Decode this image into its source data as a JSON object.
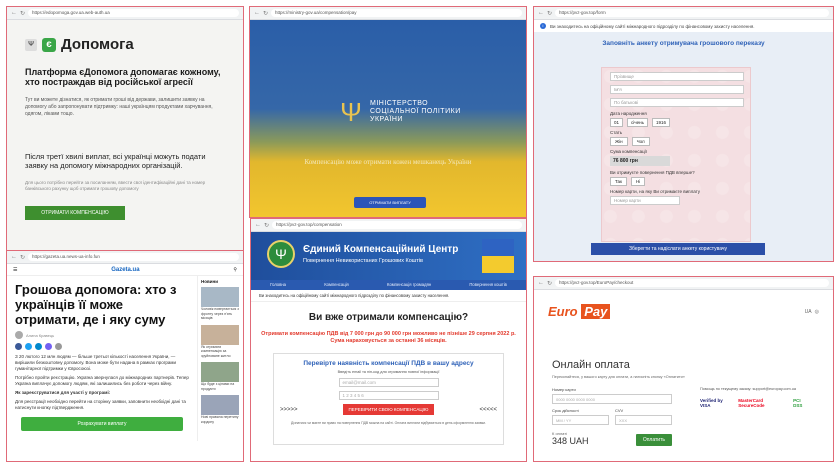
{
  "panel1": {
    "url": "https://edopomoga.gov.ua.web-auth.ua",
    "logo_name": "Допомога",
    "title": "Платформа єДопомога допомагає кожному, хто постраждав від російської агресії",
    "text": "Тут ви можете дізнатися, як отримати гроші від держави, залишити заявку на допомогу або запропонувати підтримку: наші українцям продуктами харчування, одягом, ліками тощо.",
    "subtitle": "Після третї хвилі виплат, всі українці можуть подати заявку на допомогу міжнародних організацій.",
    "small": "Для цього потрібно перейти за посиланням, ввести свої ідентифікаційні дані та номер банківського рахунку щоб отримати грошову допомогу",
    "button": "ОТРИМАТИ КОМПЕНСАЦІЮ"
  },
  "panel2": {
    "url": "https://ministry-gov.ua/compensation/pay",
    "ministry": [
      "МІНІСТЕРСТВО",
      "СОЦІАЛЬНОЇ ПОЛІТИКИ",
      "УКРАЇНИ"
    ],
    "caption": "Компенсацію може отримати кожен мешканець України",
    "button": "ОТРИМАТИ ВИПЛАТУ"
  },
  "panel3": {
    "url": "https://pvz-gov.top/form",
    "notice": "Ви знаходитесь на офіційному сайті міжнародного підрозділу по фінансовому захисту населення.",
    "title": "Заповніть анкету отримувача грошового переказу",
    "fields": [
      "Прізвище",
      "Ім'я",
      "По батькові"
    ],
    "birth_label": "Дата народження",
    "day": "01",
    "month": "січень",
    "year": "1916",
    "gender_label": "Стать",
    "gender_f": "Жін",
    "gender_m": "Чол",
    "sum_label": "Сума компенсації",
    "sum": "76 800 грн",
    "vat_label": "Ви отримуєте повернення ПДВ вперше?",
    "yes": "Так",
    "no": "Ні",
    "card_label": "Номер карти, на яку Ви отримаєте виплату",
    "card_placeholder": "Номер карти",
    "submit": "Зберегти та надіслати анкету користувачу"
  },
  "panel4": {
    "url": "https://gazeta.ua.news-ua-info.fun",
    "logo": "Gazeta.ua",
    "title": "Грошова допомога: хто з українців її може отримати, де і яку суму",
    "author": "Алина Кравець",
    "p1": "З 20 лютого 12 млн людям — більше третьої кількості населення України, — вирішили безкоштовну допомогу. Вона може бути надана в рамках програми гуманітарної підтримки у Євросоюзі.",
    "p2": "Потрібно пройти реєстрацію. Україна звернулася до міжнародних партнерів. Тепер Україна виплачує допомогу людям, які залишились без роботи через війну.",
    "h": "Як зареєструватися для участі у програмі:",
    "p3": "Для реєстрації необхідно перейти на сторінку заявки, заповнити необхідні дані та натиснути кнопку підтвердження.",
    "cta": "Розрахувати виплату",
    "side_title": "Новини",
    "side_items": [
      "Чоловік повертається з фронту через п'ять місяців",
      "Як отримати компенсацію за зруйноване житло",
      "Що буде з цінами на продукти",
      "Нові правила перетину кордону"
    ]
  },
  "panel5": {
    "url": "https://pvz-gov.top/compensation",
    "h1": "Єдиний Компенсаційний Центр",
    "h2": "Повернення Невикористаних Грошових Коштів",
    "nav": [
      "Головна",
      "Компенсація",
      "Компенсація громадян",
      "Повернення коштів"
    ],
    "notice": "Ви знаходитесь на офіційному сайті міжнародного підрозділу по фінансовому захисту населення.",
    "title": "Ви вже отримали компенсацію?",
    "red": "Отримати компенсацію ПДВ від 7 000 грн до 90 000 грн можливо не пізніше 29 серпня 2022 р. Сума нараховується за останні 36 місяців.",
    "box_title": "Перевірте наявність компенсації ПДВ в вашу адресу",
    "box_sub": "Введіть email та пін-код для отримання повної інформації",
    "email_placeholder": "email@mail.com",
    "pin_placeholder": "1 2 3 4 5 6",
    "arrows_l": ">>>>>",
    "arrows_r": "<<<<<",
    "button": "ПЕРЕВІРИТИ СВОЮ КОМПЕНСАЦІЮ",
    "footer": "Дізнатися чи маєте ви право на повернення ПДВ можна на сайті. Оплата виплати відбувається в день оформлення заявки."
  },
  "panel6": {
    "url": "https://pvz-gov.top/EuroPay/checkout",
    "logo_word": "Euro",
    "logo_box": "Pay",
    "lang": "UA",
    "title": "Онлайн оплата",
    "note": "Переконайтеся, у вашого карту для оплати, а натисніть кнопку «Оплатити»",
    "card_label": "Номер карти",
    "card_placeholder": "0000 0000 0000 0000",
    "exp_label": "Срок дійсності",
    "exp_placeholder": "MM / YY",
    "cvv_label": "CVV",
    "cvv_placeholder": "XXX",
    "amount_label": "К оплаті",
    "amount": "348 UAH",
    "pay": "Оплатить",
    "help": "Помощь по текущему заказу: support@europay.com.ua",
    "cards": [
      "Verified by VISA",
      "MasterCard SecureCode",
      "PCI DSS"
    ]
  }
}
